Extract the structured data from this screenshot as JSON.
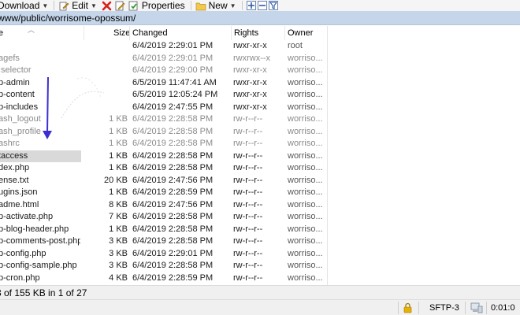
{
  "toolbar": {
    "download_label": "Download",
    "edit_label": "Edit",
    "properties_label": "Properties",
    "new_label": "New",
    "icons": [
      "download-icon",
      "edit-icon",
      "delete-icon",
      "rename-icon",
      "properties-icon",
      "new-folder-icon",
      "plus-icon",
      "minus-icon",
      "filter-icon"
    ]
  },
  "path": "www/public/worrisome-opossum/",
  "columns": {
    "name": "e",
    "size": "Size",
    "changed": "Changed",
    "rights": "Rights",
    "owner": "Owner"
  },
  "files": [
    {
      "name": "",
      "size": "",
      "changed": "6/4/2019 2:29:01 PM",
      "rights": "rwxr-xr-x",
      "owner": "root",
      "hidden": false
    },
    {
      "name": "agefs",
      "size": "",
      "changed": "6/4/2019 2:29:01 PM",
      "rights": "rwxrwx--x",
      "owner": "worriso...",
      "hidden": true
    },
    {
      "name": ".selector",
      "size": "",
      "changed": "6/4/2019 2:29:00 PM",
      "rights": "rwxr-xr-x",
      "owner": "worriso...",
      "hidden": true
    },
    {
      "name": "p-admin",
      "size": "",
      "changed": "6/5/2019 11:47:41 AM",
      "rights": "rwxr-xr-x",
      "owner": "worriso...",
      "hidden": false
    },
    {
      "name": "p-content",
      "size": "",
      "changed": "6/5/2019 12:05:24 PM",
      "rights": "rwxr-xr-x",
      "owner": "worriso...",
      "hidden": false
    },
    {
      "name": "p-includes",
      "size": "",
      "changed": "6/4/2019 2:47:55 PM",
      "rights": "rwxr-xr-x",
      "owner": "worriso...",
      "hidden": false
    },
    {
      "name": "ash_logout",
      "size": "1 KB",
      "changed": "6/4/2019 2:28:58 PM",
      "rights": "rw-r--r--",
      "owner": "worriso...",
      "hidden": true
    },
    {
      "name": "ash_profile",
      "size": "1 KB",
      "changed": "6/4/2019 2:28:58 PM",
      "rights": "rw-r--r--",
      "owner": "worriso...",
      "hidden": true
    },
    {
      "name": "ashrc",
      "size": "1 KB",
      "changed": "6/4/2019 2:28:58 PM",
      "rights": "rw-r--r--",
      "owner": "worriso...",
      "hidden": true
    },
    {
      "name": "taccess",
      "size": "1 KB",
      "changed": "6/4/2019 2:28:58 PM",
      "rights": "rw-r--r--",
      "owner": "worriso...",
      "hidden": false,
      "selected": true
    },
    {
      "name": "dex.php",
      "size": "1 KB",
      "changed": "6/4/2019 2:28:58 PM",
      "rights": "rw-r--r--",
      "owner": "worriso...",
      "hidden": false
    },
    {
      "name": "ense.txt",
      "size": "20 KB",
      "changed": "6/4/2019 2:47:56 PM",
      "rights": "rw-r--r--",
      "owner": "worriso...",
      "hidden": false
    },
    {
      "name": "ugins.json",
      "size": "1 KB",
      "changed": "6/4/2019 2:28:59 PM",
      "rights": "rw-r--r--",
      "owner": "worriso...",
      "hidden": false
    },
    {
      "name": "adme.html",
      "size": "8 KB",
      "changed": "6/4/2019 2:47:56 PM",
      "rights": "rw-r--r--",
      "owner": "worriso...",
      "hidden": false
    },
    {
      "name": "p-activate.php",
      "size": "7 KB",
      "changed": "6/4/2019 2:28:58 PM",
      "rights": "rw-r--r--",
      "owner": "worriso...",
      "hidden": false
    },
    {
      "name": "p-blog-header.php",
      "size": "1 KB",
      "changed": "6/4/2019 2:28:58 PM",
      "rights": "rw-r--r--",
      "owner": "worriso...",
      "hidden": false
    },
    {
      "name": "p-comments-post.php",
      "size": "3 KB",
      "changed": "6/4/2019 2:28:58 PM",
      "rights": "rw-r--r--",
      "owner": "worriso...",
      "hidden": false
    },
    {
      "name": "p-config.php",
      "size": "3 KB",
      "changed": "6/4/2019 2:29:01 PM",
      "rights": "rw-r--r--",
      "owner": "worriso...",
      "hidden": false
    },
    {
      "name": "p-config-sample.php",
      "size": "3 KB",
      "changed": "6/4/2019 2:28:58 PM",
      "rights": "rw-r--r--",
      "owner": "worriso...",
      "hidden": false
    },
    {
      "name": "p-cron.php",
      "size": "4 KB",
      "changed": "6/4/2019 2:28:59 PM",
      "rights": "rw-r--r--",
      "owner": "worriso...",
      "hidden": false
    }
  ],
  "status": {
    "selection_text": "3 of 155 KB in 1 of 27",
    "protocol": "SFTP-3",
    "time": "0:01:0",
    "icons": [
      "lock-icon",
      "computer-icon"
    ]
  },
  "colors": {
    "path_bar": "#c5d6ea",
    "selected_row": "#d9d9d9",
    "annotation_arrow": "#3b2fd0",
    "hidden_text": "#8a8a8a"
  }
}
